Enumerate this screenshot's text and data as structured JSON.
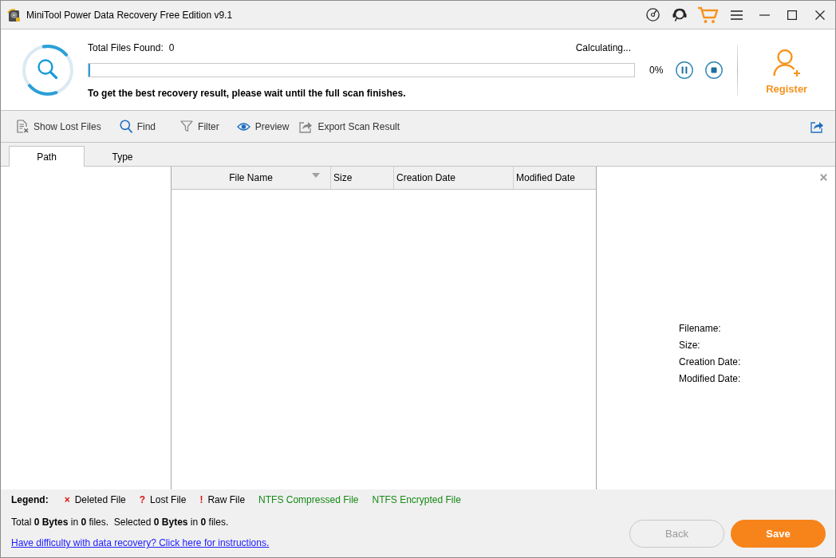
{
  "window": {
    "title": "MiniTool Power Data Recovery Free Edition v9.1"
  },
  "scan": {
    "found_label": "Total Files Found:",
    "found_count": "0",
    "status": "Calculating...",
    "level": 0,
    "percent": "0%",
    "hint": "To get the best recovery result, please wait until the full scan finishes."
  },
  "register": {
    "label": "Register"
  },
  "toolbar": [
    {
      "label": "Show Lost Files"
    },
    {
      "label": "Find"
    },
    {
      "label": "Filter"
    },
    {
      "label": "Preview"
    },
    {
      "label": "Export Scan Result"
    }
  ],
  "tabs": [
    {
      "label": "Path",
      "selected": true
    },
    {
      "label": "Type",
      "selected": false
    }
  ],
  "table": {
    "columns": [
      {
        "label": "File Name",
        "sorted": true
      },
      {
        "label": "Size",
        "sorted": false
      },
      {
        "label": "Creation Date",
        "sorted": false
      },
      {
        "label": "Modified Date",
        "sorted": false
      }
    ]
  },
  "preview": {
    "fields": [
      "Filename:",
      "Size:",
      "Creation Date:",
      "Modified Date:"
    ]
  },
  "legend": {
    "title": "Legend:",
    "items": [
      {
        "mark": "×",
        "label": "Deleted File",
        "color": "#000000"
      },
      {
        "mark": "?",
        "label": "Lost File",
        "color": "#000000"
      },
      {
        "mark": "!",
        "label": "Raw File",
        "color": "#000000"
      },
      {
        "label": "NTFS Compressed File",
        "color": "#178a17"
      },
      {
        "label": "NTFS Encrypted File",
        "color": "#178a17"
      }
    ]
  },
  "summary": "Total **0 Bytes** in **0** files.  Selected **0 Bytes** in **0** files.",
  "help_link": "Have difficulty with data recovery? Click here for instructions.",
  "buttons": [
    {
      "label": "Back",
      "kind": "secondary",
      "disabled": true
    },
    {
      "label": "Save",
      "kind": "primary",
      "disabled": false
    }
  ]
}
